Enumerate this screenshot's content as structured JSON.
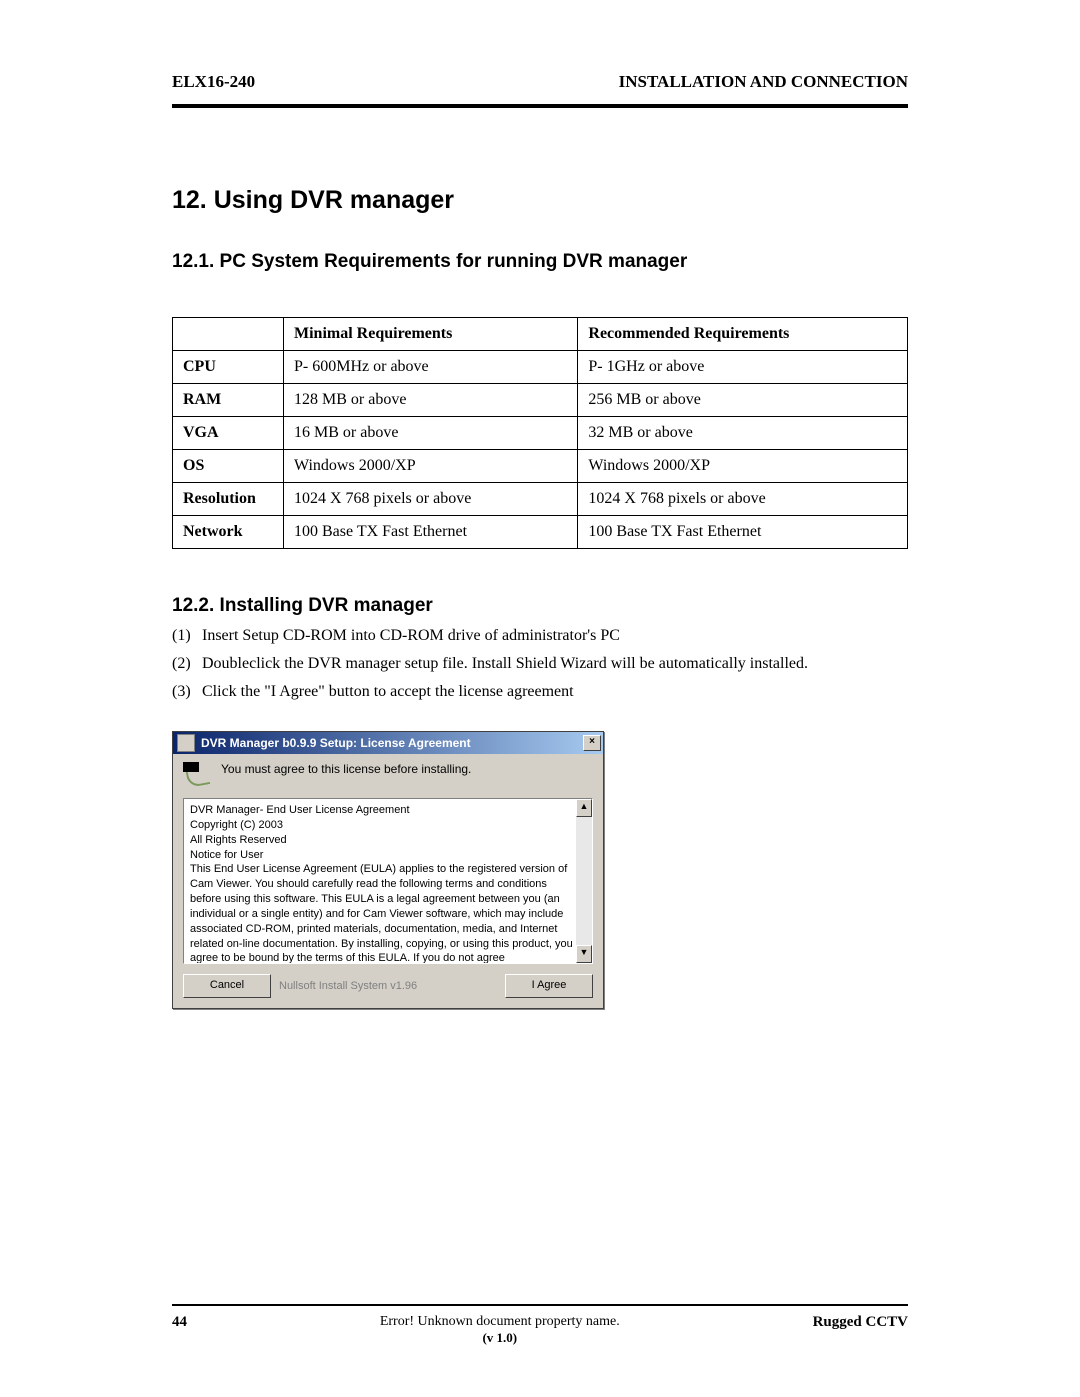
{
  "header": {
    "left": "ELX16-240",
    "right": "INSTALLATION AND CONNECTION"
  },
  "section": {
    "title": "12. Using DVR manager"
  },
  "sub1": {
    "title": "12.1. PC System Requirements for running DVR manager"
  },
  "table": {
    "h_min": "Minimal Requirements",
    "h_rec": "Recommended Requirements",
    "rows": {
      "cpu": {
        "label": "CPU",
        "min": "P-    600MHz or above",
        "rec": "P-    1GHz or above"
      },
      "ram": {
        "label": "RAM",
        "min": "128 MB or above",
        "rec": "256 MB or above"
      },
      "vga": {
        "label": "VGA",
        "min": "16 MB or above",
        "rec": "32 MB or above"
      },
      "os": {
        "label": "OS",
        "min": "Windows 2000/XP",
        "rec": "Windows 2000/XP"
      },
      "res": {
        "label": "Resolution",
        "min": "1024 X 768 pixels  or above",
        "rec": "1024 X 768 pixels  or above"
      },
      "net": {
        "label": "Network",
        "min": "100 Base TX Fast Ethernet",
        "rec": "100 Base TX Fast Ethernet"
      }
    }
  },
  "sub2": {
    "title": "12.2. Installing DVR manager",
    "steps": {
      "s1": "Insert Setup CD-ROM into CD-ROM drive of administrator's PC",
      "s2": "Doubleclick the DVR manager setup file. Install Shield Wizard will be automatically installed.",
      "s3": "Click the \"I Agree\" button to accept the license agreement"
    }
  },
  "dialog": {
    "title": "DVR Manager b0.9.9 Setup: License Agreement",
    "close": "×",
    "message": "You must agree to this license before installing.",
    "license": {
      "l1": "DVR Manager- End User License Agreement",
      "l2": "Copyright (C) 2003",
      "l3": "All Rights Reserved",
      "l4": "",
      "l5": "Notice for User",
      "l6": "This End User License Agreement (EULA) applies to the registered version of Cam Viewer. You should carefully read the following terms and conditions before using this software. This EULA is a legal agreement between you (an individual or a single entity) and                         for Cam Viewer software, which may include associated CD-ROM, printed materials, documentation, media, and Internet related on-line documentation. By installing, copying, or using this product, you agree to be bound by the terms of this EULA. If you do not agree"
    },
    "scroll_up": "▲",
    "scroll_down": "▼",
    "buttons": {
      "cancel": "Cancel",
      "installer": "Nullsoft Install System v1.96",
      "agree": "I Agree"
    }
  },
  "footer": {
    "page": "44",
    "center": "Error! Unknown document property name.",
    "version": "(v 1.0)",
    "right": "Rugged CCTV"
  }
}
